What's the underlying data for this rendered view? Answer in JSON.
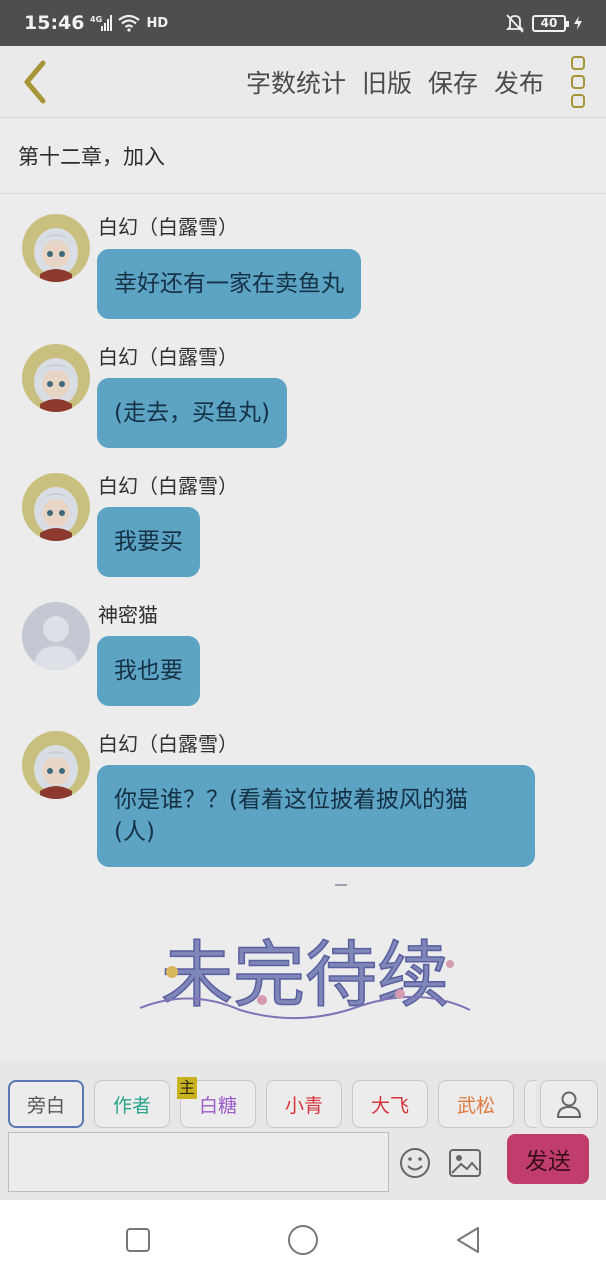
{
  "status_bar": {
    "time": "15:46",
    "network": "4G",
    "hd": "HD",
    "battery": "40"
  },
  "header": {
    "actions": [
      "字数统计",
      "旧版",
      "保存",
      "发布"
    ]
  },
  "chapter_title": "第十二章，加入",
  "messages": [
    {
      "sender": "白幻（白露雪）",
      "text": "幸好还有一家在卖鱼丸",
      "avatar": "anime-girl"
    },
    {
      "sender": "白幻（白露雪）",
      "text": "(走去，买鱼丸)",
      "avatar": "anime-girl"
    },
    {
      "sender": "白幻（白露雪）",
      "text": "我要买",
      "avatar": "anime-girl"
    },
    {
      "sender": "神密猫",
      "text": "我也要",
      "avatar": "default-person"
    },
    {
      "sender": "白幻（白露雪）",
      "text": "你是谁？？(看着这位披着披风的猫\n(人)",
      "avatar": "anime-girl"
    }
  ],
  "continued_banner": "未完待续",
  "roles": [
    {
      "label": "旁白",
      "color": "#555555",
      "selected": true
    },
    {
      "label": "作者",
      "color": "#2aa58a",
      "selected": false
    },
    {
      "label": "白糖",
      "color": "#9a5bc9",
      "selected": false,
      "tag": "主"
    },
    {
      "label": "小青",
      "color": "#d8323a",
      "selected": false
    },
    {
      "label": "大飞",
      "color": "#d8323a",
      "selected": false
    },
    {
      "label": "武松",
      "color": "#e07a3c",
      "selected": false
    }
  ],
  "input": {
    "placeholder": ""
  },
  "send_label": "发送",
  "colors": {
    "bubble": "#5ca3c4",
    "send": "#c13d6d",
    "accent_gold": "#a69537"
  }
}
